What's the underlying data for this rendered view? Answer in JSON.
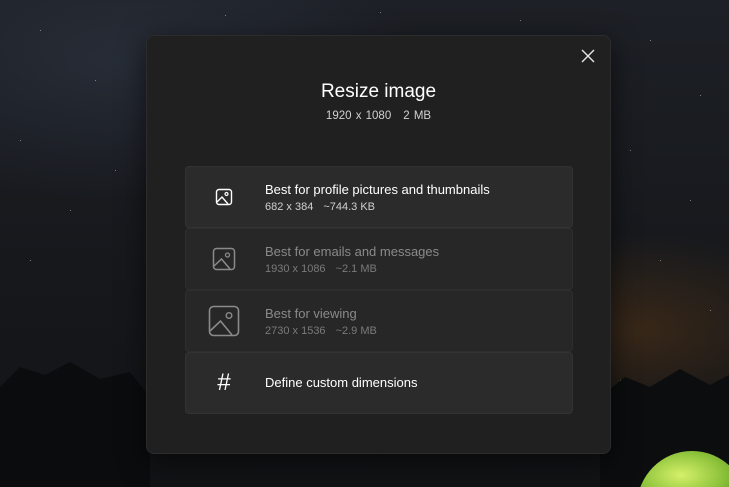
{
  "dialog": {
    "title": "Resize image",
    "original": {
      "dimensions": "1920 x 1080",
      "size": "2 MB"
    },
    "close_icon": "close-icon"
  },
  "options": [
    {
      "label": "Best for profile pictures and thumbnails",
      "dimensions": "682 x 384",
      "size": "~744.3 KB",
      "icon": "image-icon",
      "enabled": true
    },
    {
      "label": "Best for emails and messages",
      "dimensions": "1930 x 1086",
      "size": "~2.1 MB",
      "icon": "image-icon",
      "enabled": false
    },
    {
      "label": "Best for viewing",
      "dimensions": "2730 x 1536",
      "size": "~2.9 MB",
      "icon": "image-icon",
      "enabled": false
    },
    {
      "label": "Define custom dimensions",
      "icon": "hash-icon",
      "glyph": "#",
      "enabled": true
    }
  ],
  "colors": {
    "dialog_bg": "#202020",
    "option_bg": "#2b2b2b",
    "text_primary": "#ffffff",
    "text_disabled": "#8a8a8a"
  }
}
